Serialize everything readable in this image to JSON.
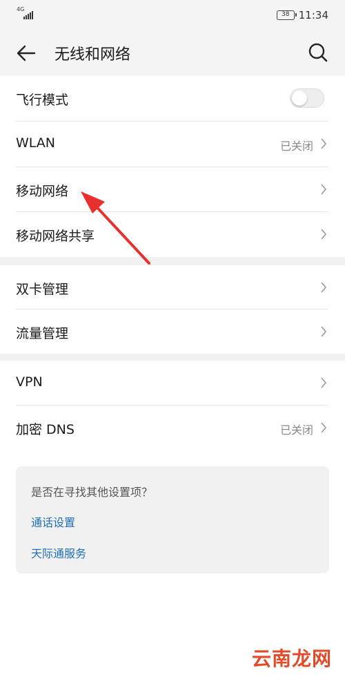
{
  "status_bar": {
    "network": "4G",
    "battery": "38",
    "time": "11:34"
  },
  "header": {
    "title": "无线和网络",
    "back_icon": "arrow-left-icon",
    "search_icon": "search-icon"
  },
  "sections": [
    {
      "items": [
        {
          "label": "飞行模式",
          "control": "toggle",
          "on": false
        },
        {
          "label": "WLAN",
          "value": "已关闭"
        },
        {
          "label": "移动网络"
        },
        {
          "label": "移动网络共享"
        }
      ]
    },
    {
      "items": [
        {
          "label": "双卡管理"
        },
        {
          "label": "流量管理"
        }
      ]
    },
    {
      "items": [
        {
          "label": "VPN"
        },
        {
          "label": "加密 DNS",
          "value": "已关闭"
        }
      ]
    }
  ],
  "suggestions": {
    "question": "是否在寻找其他设置项？",
    "links": [
      "通话设置",
      "天际通服务"
    ]
  },
  "watermark": "云南龙网",
  "colors": {
    "link": "#1e6fb8",
    "annotation_arrow": "#e8302c",
    "background_gray": "#f1f1f1"
  }
}
